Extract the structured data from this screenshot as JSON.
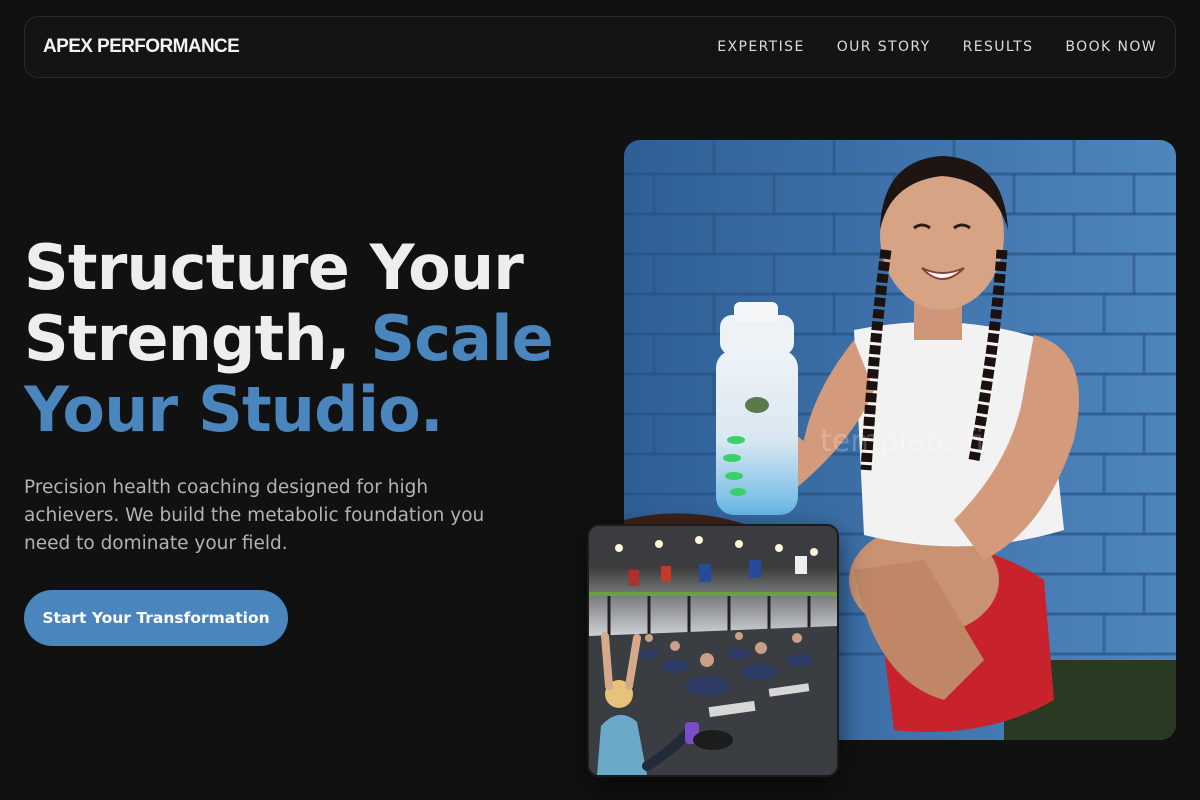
{
  "brand": {
    "name": "APEX PERFORMANCE"
  },
  "nav": {
    "links": [
      "EXPERTISE",
      "OUR STORY",
      "RESULTS",
      "BOOK NOW"
    ]
  },
  "hero": {
    "headline_line1": "Structure Your",
    "headline_line2_plain": "Strength, ",
    "headline_line2_accent": "Scale",
    "headline_line3_accent": "Your Studio.",
    "subtitle": "Precision health coaching designed for high achievers. We build the metabolic foundation you need to dominate your field.",
    "cta_label": "Start Your Transformation"
  },
  "images": {
    "main_watermark": "template.fi"
  },
  "colors": {
    "accent": "#4a86bd",
    "background": "#111111",
    "text": "#eeeeee",
    "muted_text": "#b3b3b3"
  }
}
